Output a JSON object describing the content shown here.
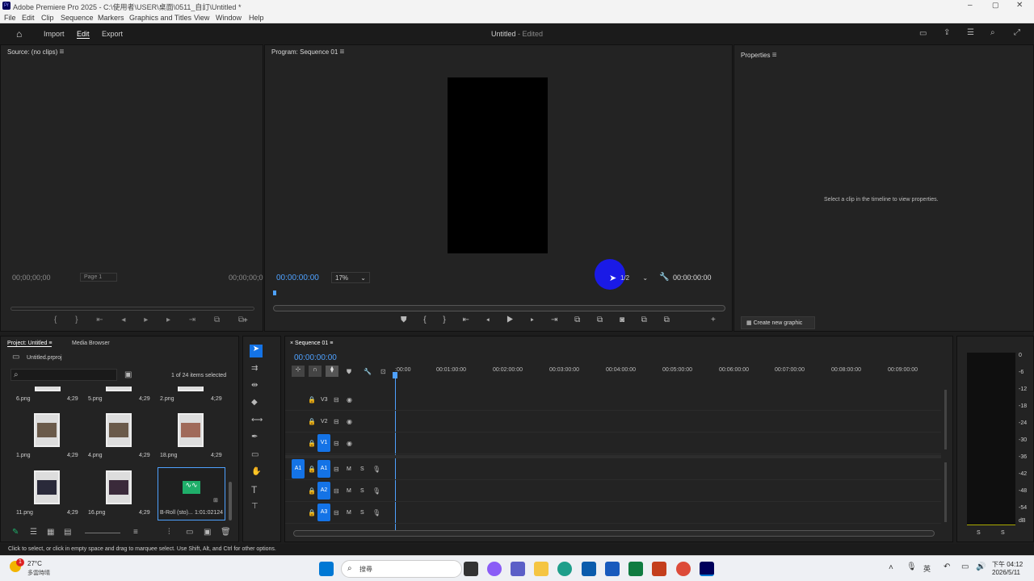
{
  "window": {
    "title": "Adobe Premiere Pro 2025 - C:\\使用者\\USER\\桌面\\0511_自訂\\Untitled *"
  },
  "menu": [
    "File",
    "Edit",
    "Clip",
    "Sequence",
    "Markers",
    "Graphics and Titles",
    "View",
    "Window",
    "Help"
  ],
  "workspace": {
    "import": "Import",
    "edit": "Edit",
    "export": "Export",
    "doc_title": "Untitled",
    "doc_status": "- Edited"
  },
  "source": {
    "title": "Source: (no clips)",
    "timecode_left": "00;00;00;00",
    "page": "Page 1",
    "timecode_right": "00;00;00;0"
  },
  "program": {
    "title": "Program: Sequence 01",
    "timecode": "00:00:00:00",
    "zoom": "17%",
    "quality": "1/2",
    "duration": "00:00:00:00"
  },
  "properties": {
    "title": "Properties",
    "hint": "Select a clip in the timeline to view properties.",
    "create_graphic": "Create new graphic"
  },
  "project": {
    "tab_project": "Project: Untitled",
    "tab_media": "Media Browser",
    "file": "Untitled.prproj",
    "selected": "1 of 24 items selected",
    "items": [
      {
        "name": "6.png",
        "dur": "4;29"
      },
      {
        "name": "5.png",
        "dur": "4;29"
      },
      {
        "name": "2.png",
        "dur": "4;29"
      },
      {
        "name": "1.png",
        "dur": "4;29"
      },
      {
        "name": "4.png",
        "dur": "4;29"
      },
      {
        "name": "18.png",
        "dur": "4;29"
      },
      {
        "name": "11.png",
        "dur": "4;29"
      },
      {
        "name": "16.png",
        "dur": "4;29"
      },
      {
        "name": "B-Roll (sto)...",
        "dur": "1:01:02124"
      }
    ]
  },
  "timeline": {
    "tab": "Sequence 01",
    "timecode": "00:00:00:00",
    "ruler": [
      ":00:00",
      "00:01:00:00",
      "00:02:00:00",
      "00:03:00:00",
      "00:04:00:00",
      "00:05:00:00",
      "00:06:00:00",
      "00:07:00:00",
      "00:08:00:00",
      "00:09:00:00"
    ],
    "video_tracks": [
      "V3",
      "V2",
      "V1"
    ],
    "audio_tracks": [
      "A1",
      "A2",
      "A3"
    ],
    "source_audio": "A1",
    "mute": "M",
    "solo": "S"
  },
  "meter": {
    "scale": [
      "0",
      "-6",
      "-12",
      "-18",
      "-24",
      "-30",
      "-36",
      "-42",
      "-48",
      "-54",
      "dB"
    ],
    "channels": [
      "S",
      "S"
    ]
  },
  "status": {
    "text": "Click to select, or click in empty space and drag to marquee select. Use Shift, Alt, and Ctrl for other options."
  },
  "taskbar": {
    "weather_temp": "27°C",
    "weather_desc": "多雲時晴",
    "search": "搜尋",
    "time": "下午 04:12",
    "date": "2026/5/11",
    "lang": "英",
    "badge": "1"
  }
}
